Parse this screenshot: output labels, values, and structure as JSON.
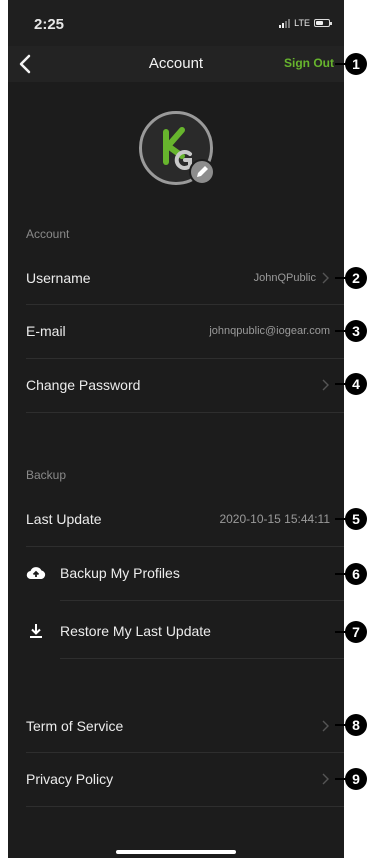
{
  "status_bar": {
    "time": "2:25",
    "network": "LTE"
  },
  "nav": {
    "title": "Account",
    "sign_out": "Sign Out"
  },
  "account_section": {
    "label": "Account",
    "username_label": "Username",
    "username_value": "JohnQPublic",
    "email_label": "E-mail",
    "email_value": "johnqpublic@iogear.com",
    "change_password_label": "Change Password"
  },
  "backup_section": {
    "label": "Backup",
    "last_update_label": "Last Update",
    "last_update_value": "2020-10-15 15:44:11",
    "backup_label": "Backup My Profiles",
    "restore_label": "Restore My Last Update"
  },
  "legal": {
    "terms_label": "Term of Service",
    "privacy_label": "Privacy Policy"
  },
  "callouts": [
    "1",
    "2",
    "3",
    "4",
    "5",
    "6",
    "7",
    "8",
    "9"
  ],
  "colors": {
    "accent": "#67b52d",
    "background": "#1c1c1c",
    "text": "#ececec",
    "muted": "#9a9a9a"
  }
}
